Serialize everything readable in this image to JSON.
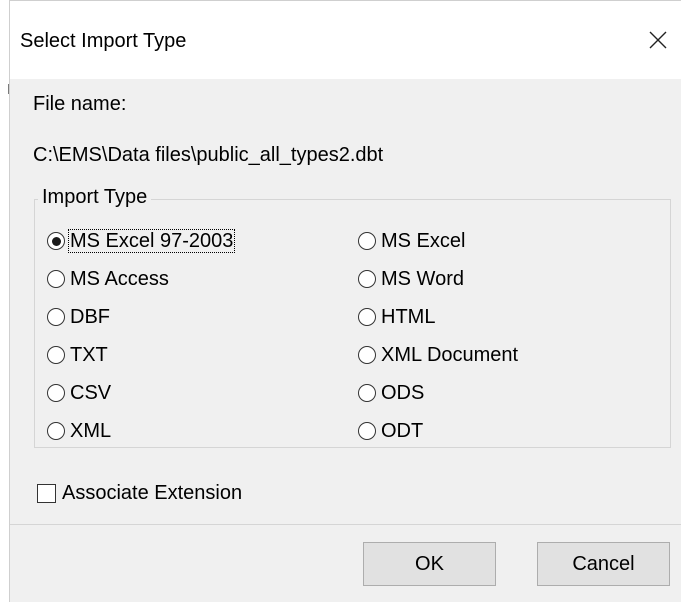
{
  "dialog": {
    "title": "Select Import Type",
    "close_icon": "close-icon",
    "file_name_label": "File name:",
    "file_path": "C:\\EMS\\Data files\\public_all_types2.dbt",
    "import_type": {
      "legend": "Import Type",
      "selected": "MS Excel 97-2003",
      "options_left": [
        "MS Excel 97-2003",
        "MS Access",
        "DBF",
        "TXT",
        "CSV",
        "XML"
      ],
      "options_right": [
        "MS Excel",
        "MS Word",
        "HTML",
        "XML Document",
        "ODS",
        "ODT"
      ]
    },
    "associate_extension": {
      "label": "Associate Extension",
      "checked": false
    },
    "buttons": {
      "ok": "OK",
      "cancel": "Cancel"
    }
  }
}
